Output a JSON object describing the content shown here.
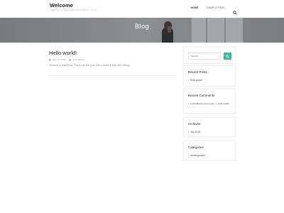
{
  "header": {
    "site_title": "Welcome",
    "tagline": "Just another WordPress site",
    "nav": [
      {
        "label": "Home"
      },
      {
        "label": "Sample Page"
      }
    ],
    "search_icon": "search-icon"
  },
  "hero": {
    "title": "Blog"
  },
  "post": {
    "title": "Hello world!",
    "date": "July 13, 2018",
    "comments": "1 Comment",
    "excerpt": "Welcome to WordPress. This is your first post. Edit or delete it, then start writing!"
  },
  "sidebar": {
    "search": {
      "placeholder": "Search...",
      "button_icon": "search-icon",
      "accent": "#3cb7a0"
    },
    "recent_posts": {
      "title": "Recent Posts",
      "items": [
        "Hello world!"
      ]
    },
    "recent_comments": {
      "title": "Recent Comments",
      "author": "A WordPress Commenter",
      "on": "on",
      "post": "Hello world!"
    },
    "archives": {
      "title": "Archives",
      "items": [
        "July 2018"
      ]
    },
    "categories": {
      "title": "Categories",
      "items": [
        "Uncategorized"
      ]
    }
  }
}
